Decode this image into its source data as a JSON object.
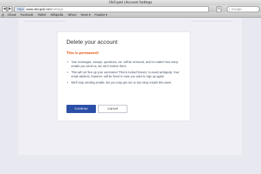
{
  "window": {
    "title": "OkCupid | Account Settings"
  },
  "toolbar": {
    "back_icon": "back-arrow-icon",
    "forward_icon": "forward-arrow-icon",
    "url_badge": "https",
    "url_host": "www.okcupid.com",
    "url_path": "/settings",
    "search_placeholder": "Google"
  },
  "bookmarks": {
    "items": [
      "iCloud",
      "Facebook",
      "Twitter",
      "Wikipedia",
      "Yahoo!",
      "News ▾",
      "Popular ▾"
    ]
  },
  "modal": {
    "title": "Delete your account",
    "warning": "This is permanent!",
    "items": [
      "Your messages, essays, questions, etc. will be removed, and no matter how many emails you send us, we can't restore them.",
      "This will not free up your username! That is locked forever, to avoid ambiguity. Your email address, however, will be freed in case you want to sign up again.",
      "We'll stop sending emails, but you may get one or two stray emails this week."
    ],
    "continue_label": "Continue",
    "cancel_label": "Cancel"
  },
  "colors": {
    "primary_button": "#2b4fa8",
    "warning": "#e55a1b",
    "overlay": "#e8e9f0"
  }
}
